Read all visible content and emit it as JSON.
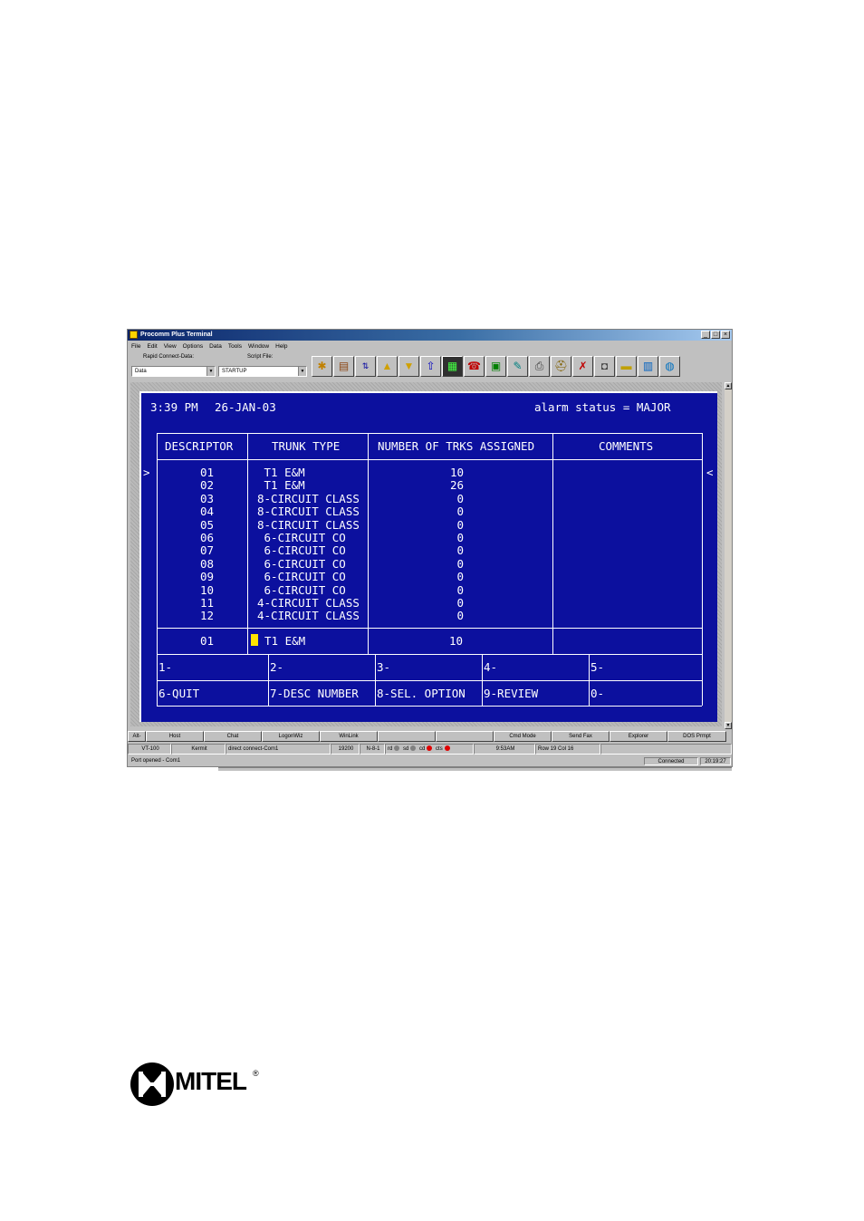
{
  "window": {
    "title": "Procomm Plus Terminal",
    "controls": [
      "_",
      "□",
      "×"
    ]
  },
  "menu": [
    "File",
    "Edit",
    "View",
    "Options",
    "Data",
    "Tools",
    "Window",
    "Help"
  ],
  "rapid_connect": {
    "label": "Rapid Connect-Data:",
    "value": "Data"
  },
  "script_file": {
    "label": "Script File:",
    "value": "STARTUP"
  },
  "toolbar_icons": [
    "run-script-icon",
    "phonebook-icon",
    "mode-icon",
    "upload-icon",
    "download-icon",
    "send-file-icon",
    "capture-icon",
    "hangup-icon",
    "monitor-icon",
    "meta-icon",
    "print-icon",
    "hat-icon",
    "setup-icon",
    "camera-icon",
    "key-icon",
    "colors-icon",
    "globe-icon"
  ],
  "terminal": {
    "time": "3:39 PM",
    "date": "26-JAN-03",
    "alarm": "alarm status = MAJOR",
    "headers": [
      "DESCRIPTOR",
      "TRUNK TYPE",
      "NUMBER OF TRKS ASSIGNED",
      "COMMENTS"
    ],
    "left_marker": ">",
    "right_marker": "<",
    "rows": [
      {
        "desc": "01",
        "type": " T1 E&M",
        "num": "10"
      },
      {
        "desc": "02",
        "type": " T1 E&M",
        "num": "26"
      },
      {
        "desc": "03",
        "type": "8-CIRCUIT CLASS",
        "num": "0"
      },
      {
        "desc": "04",
        "type": "8-CIRCUIT CLASS",
        "num": "0"
      },
      {
        "desc": "05",
        "type": "8-CIRCUIT CLASS",
        "num": "0"
      },
      {
        "desc": "06",
        "type": " 6-CIRCUIT CO",
        "num": "0"
      },
      {
        "desc": "07",
        "type": " 6-CIRCUIT CO",
        "num": "0"
      },
      {
        "desc": "08",
        "type": " 6-CIRCUIT CO",
        "num": "0"
      },
      {
        "desc": "09",
        "type": " 6-CIRCUIT CO",
        "num": "0"
      },
      {
        "desc": "10",
        "type": " 6-CIRCUIT CO",
        "num": "0"
      },
      {
        "desc": "11",
        "type": "4-CIRCUIT CLASS",
        "num": "0"
      },
      {
        "desc": "12",
        "type": "4-CIRCUIT CLASS",
        "num": "0"
      }
    ],
    "input": {
      "desc": "01",
      "type": "T1 E&M",
      "num": "10"
    },
    "softkeys_top": [
      "1-",
      "2-",
      "3-",
      "4-",
      "5-"
    ],
    "softkeys_bottom": [
      "6-QUIT",
      "7-DESC NUMBER",
      "8-SEL. OPTION",
      "9-REVIEW",
      "0-"
    ]
  },
  "button_bar": [
    "Alt-",
    "Host",
    "Chat",
    "LogonWiz",
    "WinLink",
    "",
    "Cmd Mode",
    "Send Fax",
    "Explorer",
    "DOS Prmpt"
  ],
  "status": {
    "emulation": "VT-100",
    "protocol": "Kermit",
    "connection": "direct connect-Com1",
    "baud": "19200",
    "params": "N-8-1",
    "leds": [
      "rd",
      "sd",
      "cd",
      "cts"
    ],
    "time": "9:53AM",
    "position": "Row 19   Col 16"
  },
  "bottom": {
    "message": "Port opened - Com1",
    "state": "Connected",
    "clock": "20:19:27"
  },
  "logo": {
    "text": "MITEL",
    "mark": "®"
  },
  "colors": {
    "terminal_bg": "#0c109e",
    "terminal_fg": "#ffffff",
    "cursor": "#ffe400"
  }
}
